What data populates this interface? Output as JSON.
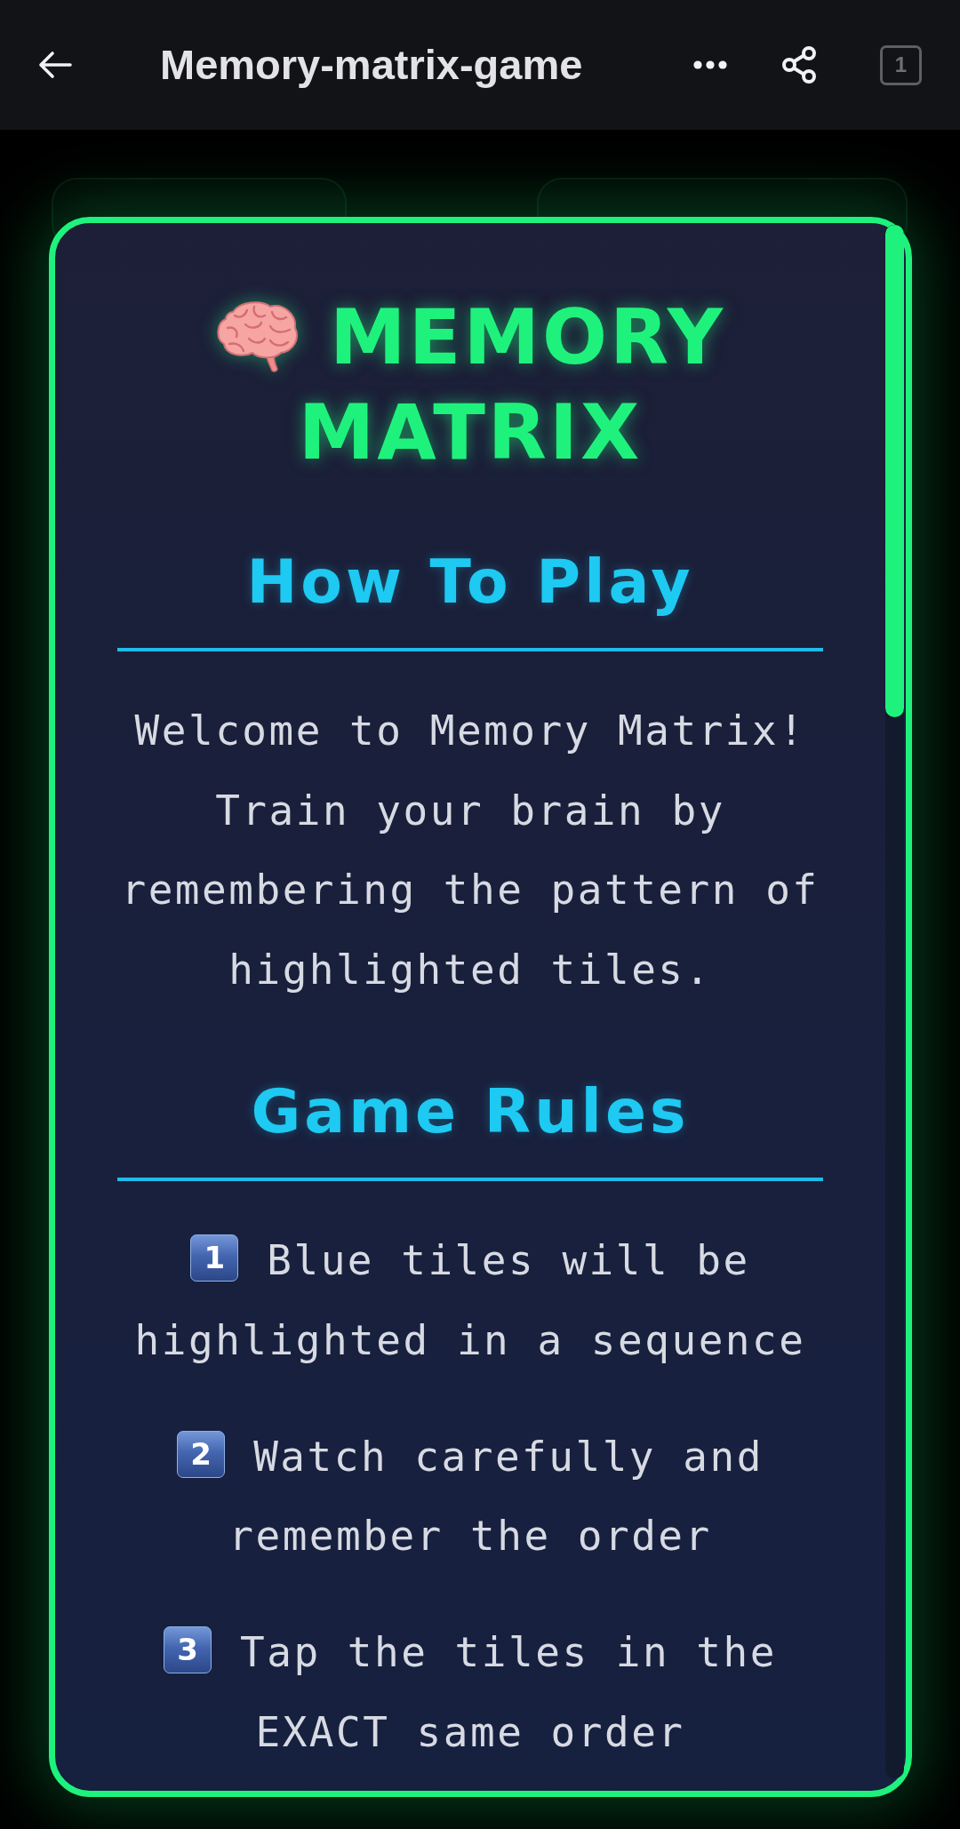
{
  "top_bar": {
    "title": "Memory-matrix-game",
    "tab_count": "1"
  },
  "card": {
    "title": "MEMORY MATRIX",
    "sections": [
      {
        "kind": "paragraph",
        "heading": "How To Play",
        "text": "Welcome to Memory Matrix! Train your brain by remembering the pattern of highlighted tiles."
      },
      {
        "kind": "steps",
        "heading": "Game Rules",
        "steps": [
          {
            "number": "1",
            "text": "Blue tiles will be highlighted in a sequence"
          },
          {
            "number": "2",
            "text": "Watch carefully and remember the order"
          },
          {
            "number": "3",
            "text": "Tap the tiles in the EXACT same order"
          }
        ]
      }
    ]
  }
}
